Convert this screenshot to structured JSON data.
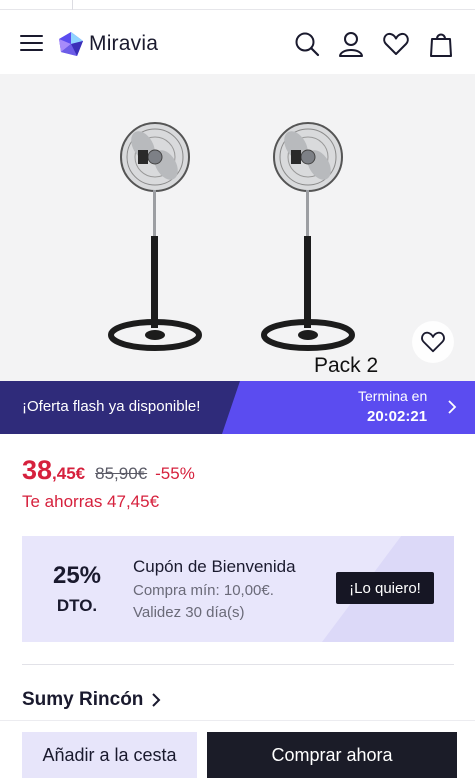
{
  "header": {
    "logo_text": "Miravia",
    "icons": [
      "menu-icon",
      "search-icon",
      "user-icon",
      "heart-icon",
      "bag-icon"
    ]
  },
  "gallery": {
    "overlay_text": "Pack 2",
    "favorite_icon": "heart-icon"
  },
  "flash_sale": {
    "label": "¡Oferta flash ya disponible!",
    "ends_label": "Termina en",
    "countdown": "20:02:21"
  },
  "price": {
    "integer": "38",
    "decimal": ",45€",
    "original": "85,90€",
    "discount": "-55%",
    "savings": "Te ahorras 47,45€"
  },
  "coupon": {
    "percent": "25%",
    "unit": "DTO.",
    "title": "Cupón de Bienvenida",
    "min_purchase": "Compra mín: 10,00€.",
    "validity": "Validez 30 día(s)",
    "button": "¡Lo quiero!"
  },
  "store": {
    "name": "Sumy Rincón"
  },
  "actions": {
    "add_to_cart": "Añadir a la cesta",
    "buy_now": "Comprar ahora"
  },
  "colors": {
    "price_red": "#d6213d",
    "flash_dark": "#2f2b7a",
    "flash_accent": "#5b4cf0",
    "coupon_bg": "#e8e6fb",
    "primary_dark": "#1b1c28"
  }
}
